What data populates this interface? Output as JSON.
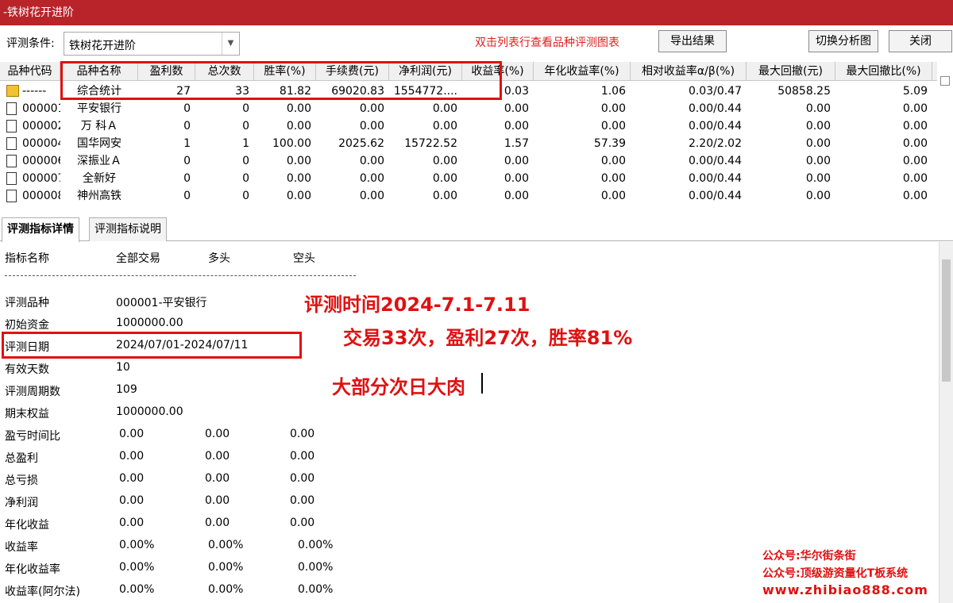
{
  "window": {
    "title": "-铁树花开进阶"
  },
  "toolbar": {
    "condition_label": "评测条件:",
    "condition_value": "铁树花开进阶",
    "hint": "双击列表行查看品种评测图表",
    "export_label": "导出结果",
    "switch_label": "切换分析图",
    "close_label": "关闭"
  },
  "grid": {
    "headers": [
      "品种代码",
      "品种名称",
      "盈利数",
      "总次数",
      "胜率(%)",
      "手续费(元)",
      "净利润(元)",
      "收益率(%)",
      "年化收益率(%)",
      "相对收益率α/β(%)",
      "最大回撤(元)",
      "最大回撤比(%)"
    ],
    "rows": [
      [
        "------",
        "综合统计",
        "27",
        "33",
        "81.82",
        "69020.83",
        "1554772....",
        "0.03",
        "1.06",
        "0.03/0.47",
        "50858.25",
        "5.09"
      ],
      [
        "000001",
        "平安银行",
        "0",
        "0",
        "0.00",
        "0.00",
        "0.00",
        "0.00",
        "0.00",
        "0.00/0.44",
        "0.00",
        "0.00"
      ],
      [
        "000002",
        "万 科Ａ",
        "0",
        "0",
        "0.00",
        "0.00",
        "0.00",
        "0.00",
        "0.00",
        "0.00/0.44",
        "0.00",
        "0.00"
      ],
      [
        "000004",
        "国华网安",
        "1",
        "1",
        "100.00",
        "2025.62",
        "15722.52",
        "1.57",
        "57.39",
        "2.20/2.02",
        "0.00",
        "0.00"
      ],
      [
        "000006",
        "深振业Ａ",
        "0",
        "0",
        "0.00",
        "0.00",
        "0.00",
        "0.00",
        "0.00",
        "0.00/0.44",
        "0.00",
        "0.00"
      ],
      [
        "000007",
        "全新好",
        "0",
        "0",
        "0.00",
        "0.00",
        "0.00",
        "0.00",
        "0.00",
        "0.00/0.44",
        "0.00",
        "0.00"
      ],
      [
        "000008",
        "神州高铁",
        "0",
        "0",
        "0.00",
        "0.00",
        "0.00",
        "0.00",
        "0.00",
        "0.00/0.44",
        "0.00",
        "0.00"
      ]
    ]
  },
  "tabs": [
    "评测指标详情",
    "评测指标说明"
  ],
  "detail": {
    "header": [
      "指标名称",
      "全部交易",
      "多头",
      "空头"
    ],
    "info": [
      {
        "label": "评测品种",
        "value": "000001-平安银行"
      },
      {
        "label": "初始资金",
        "value": "1000000.00"
      },
      {
        "label": "评测日期",
        "value": "2024/07/01-2024/07/11"
      },
      {
        "label": "有效天数",
        "value": "10"
      },
      {
        "label": "评测周期数",
        "value": "109"
      },
      {
        "label": "期末权益",
        "value": "1000000.00"
      }
    ],
    "metrics": [
      {
        "label": "盈亏时间比",
        "all": "0.00",
        "long": "0.00",
        "short": "0.00"
      },
      {
        "label": "总盈利",
        "all": "0.00",
        "long": "0.00",
        "short": "0.00"
      },
      {
        "label": "总亏损",
        "all": "0.00",
        "long": "0.00",
        "short": "0.00"
      },
      {
        "label": "净利润",
        "all": "0.00",
        "long": "0.00",
        "short": "0.00"
      },
      {
        "label": "年化收益",
        "all": "0.00",
        "long": "0.00",
        "short": "0.00"
      },
      {
        "label": "收益率",
        "all": "0.00%",
        "long": "0.00%",
        "short": "0.00%"
      },
      {
        "label": "年化收益率",
        "all": "0.00%",
        "long": "0.00%",
        "short": "0.00%"
      },
      {
        "label": "收益率(阿尔法)",
        "all": "0.00%",
        "long": "0.00%",
        "short": "0.00%"
      }
    ]
  },
  "annotations": {
    "line1": "评测时间2024-7.1-7.11",
    "line2": "交易33次，盈利27次，胜率81%",
    "line3": "大部分次日大肉"
  },
  "watermark": {
    "line1": "公众号:华尔街条街",
    "line2": "公众号:顶级游资量化T板系统",
    "line3": "www.zhibiao888.com"
  }
}
